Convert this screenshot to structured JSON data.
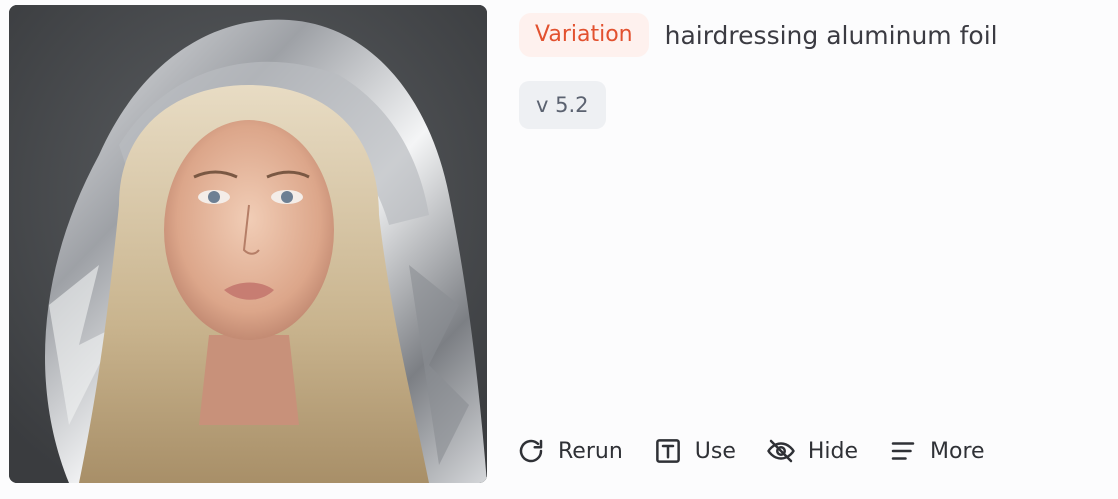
{
  "image": {
    "alt": "portrait-image-icon"
  },
  "header": {
    "badge_label": "Variation",
    "prompt": "hairdressing aluminum foil"
  },
  "version": {
    "label": "v 5.2"
  },
  "actions": [
    {
      "label": "Rerun",
      "icon": "rerun-icon"
    },
    {
      "label": "Use",
      "icon": "text-box-icon"
    },
    {
      "label": "Hide",
      "icon": "eye-off-icon"
    },
    {
      "label": "More",
      "icon": "menu-lines-icon"
    }
  ],
  "colors": {
    "badge_text": "#e2512f",
    "badge_bg": "#fef1ee",
    "version_bg": "#eef0f3"
  }
}
